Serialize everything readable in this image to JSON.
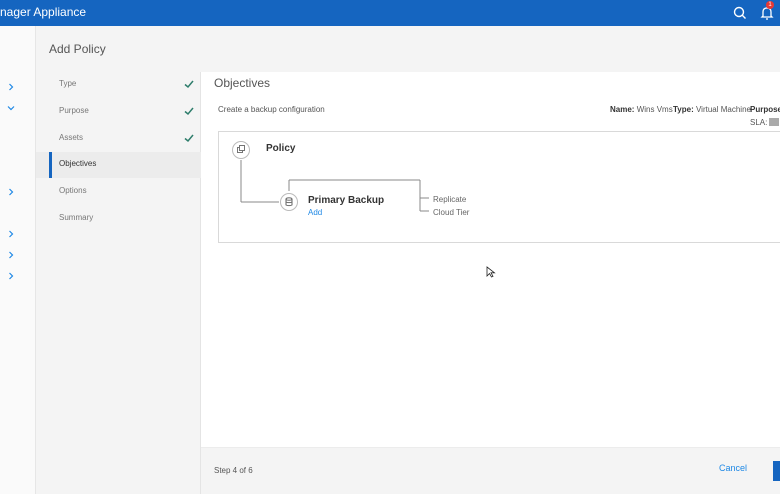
{
  "app": {
    "title": "nager Appliance"
  },
  "header": {
    "title": "Add Policy"
  },
  "notifications": {
    "count": "1"
  },
  "steps": [
    {
      "label": "Type",
      "done": true
    },
    {
      "label": "Purpose",
      "done": true
    },
    {
      "label": "Assets",
      "done": true
    },
    {
      "label": "Objectives",
      "active": true
    },
    {
      "label": "Options"
    },
    {
      "label": "Summary"
    }
  ],
  "objectives": {
    "title": "Objectives",
    "subtitle": "Create a backup configuration",
    "meta": {
      "name_key": "Name:",
      "name_value": "Wins Vms",
      "type_key": "Type:",
      "type_value": "Virtual Machine",
      "purpose_key": "Purpose:"
    },
    "sla_label": "SLA:",
    "tree": {
      "root": "Policy",
      "primary": "Primary Backup",
      "add": "Add",
      "branches": [
        "Replicate",
        "Cloud Tier"
      ]
    }
  },
  "footer": {
    "step": "Step 4 of 6",
    "cancel": "Cancel"
  },
  "colors": {
    "brand": "#1565c0",
    "check": "#2e7d6b",
    "link": "#1e88e5"
  },
  "icons": {
    "search": "search-icon",
    "bell": "bell-icon",
    "check": "checkmark-icon",
    "policy": "copy-icon",
    "backup": "database-icon",
    "sla": "list-icon"
  }
}
